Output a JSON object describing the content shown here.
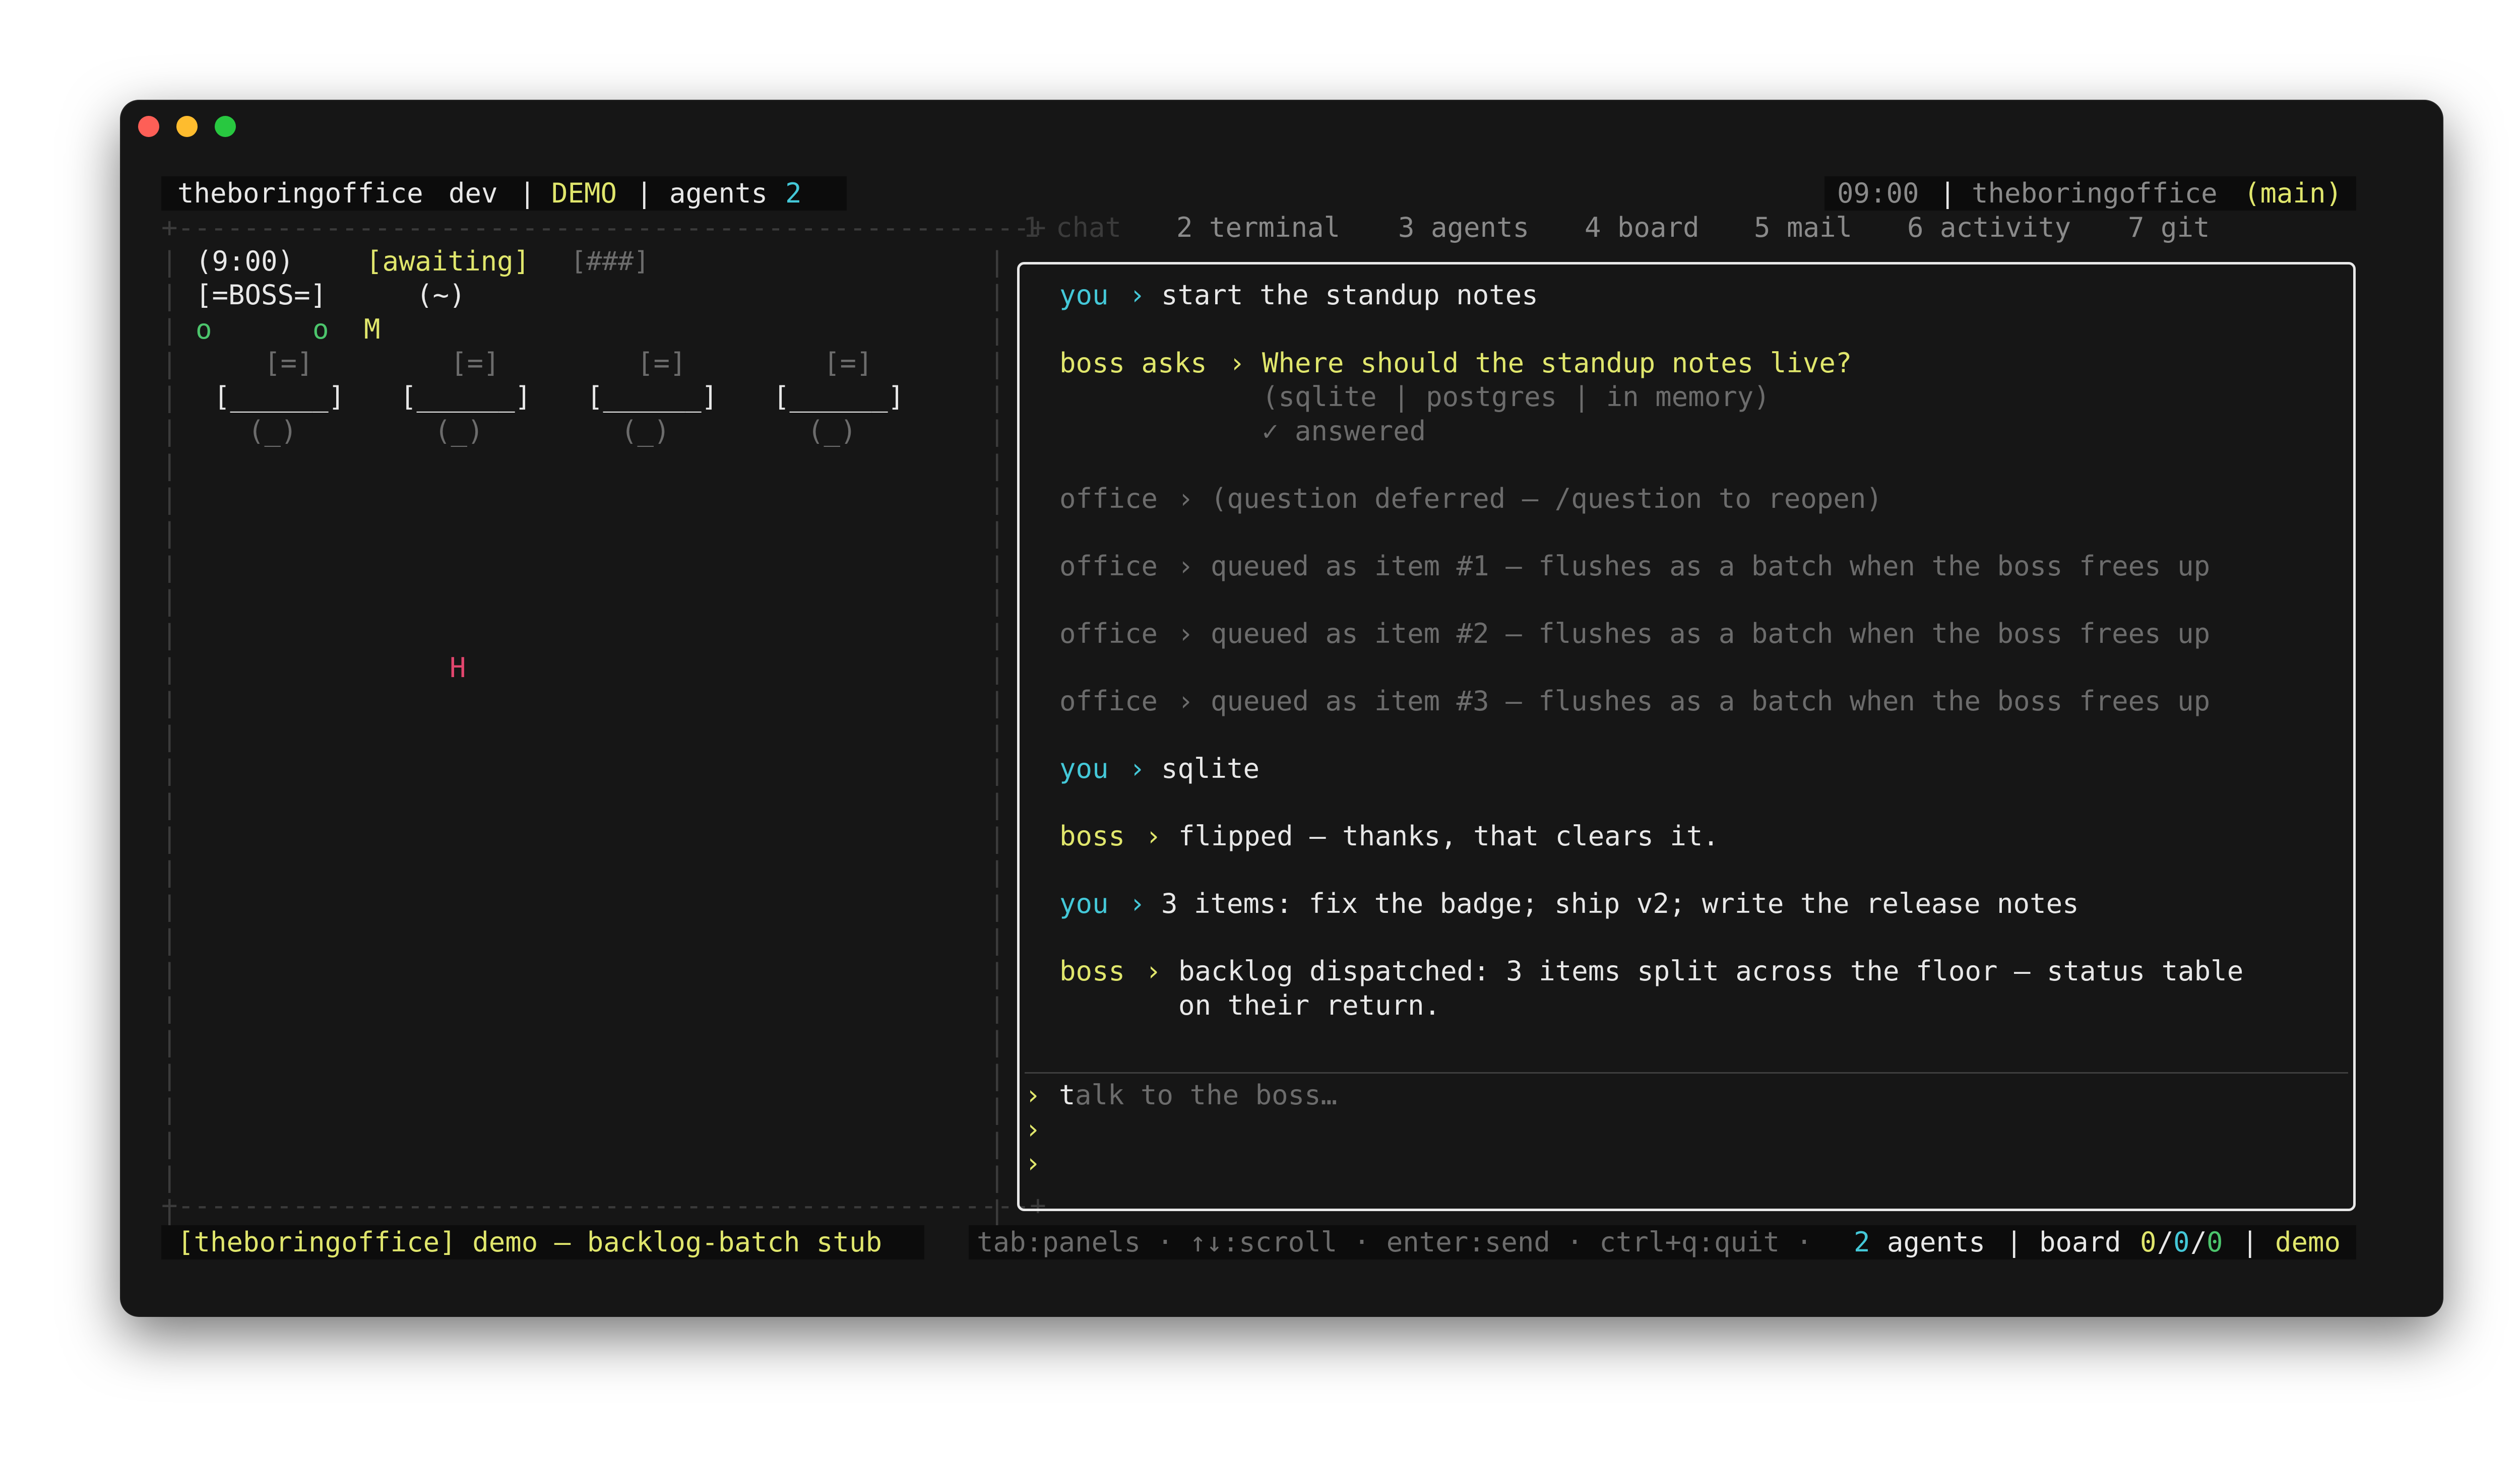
{
  "header": {
    "app_name": "theboringoffice",
    "mode": "dev",
    "sep": "|",
    "demo_label": "DEMO",
    "agents_label": "agents",
    "agents_count": "2",
    "clock": "09:00",
    "repo_name": "theboringoffice",
    "branch": "(main)"
  },
  "tabs": [
    {
      "label": "1 chat"
    },
    {
      "label": "2 terminal"
    },
    {
      "label": "3 agents"
    },
    {
      "label": "4 board"
    },
    {
      "label": "5 mail"
    },
    {
      "label": "6 activity"
    },
    {
      "label": "7 git"
    }
  ],
  "office": {
    "time": "(9:00)",
    "status": "[awaiting]",
    "progress": "[###]",
    "boss_desk": "[=BOSS=]",
    "boss_face": "(~)",
    "agent_a": "o",
    "agent_b": "o",
    "agent_m": "M",
    "monitor": "[=]",
    "desk": "[______]",
    "chair": "(_)",
    "marker_h": "H"
  },
  "chat": {
    "messages": [
      {
        "speaker": "you",
        "sep": "›",
        "text": "start the standup notes"
      },
      {
        "speaker": "boss asks",
        "sep": "›",
        "text": "Where should the standup notes live?",
        "options": "(sqlite | postgres | in memory)",
        "status": "✓ answered"
      },
      {
        "speaker": "office",
        "sep": "›",
        "text": "(question deferred — /question to reopen)"
      },
      {
        "speaker": "office",
        "sep": "›",
        "text": "queued as item #1 — flushes as a batch when the boss frees up"
      },
      {
        "speaker": "office",
        "sep": "›",
        "text": "queued as item #2 — flushes as a batch when the boss frees up"
      },
      {
        "speaker": "office",
        "sep": "›",
        "text": "queued as item #3 — flushes as a batch when the boss frees up"
      },
      {
        "speaker": "you",
        "sep": "›",
        "text": "sqlite"
      },
      {
        "speaker": "boss",
        "sep": "›",
        "text": "flipped — thanks, that clears it."
      },
      {
        "speaker": "you",
        "sep": "›",
        "text": "3 items: fix the badge; ship v2; write the release notes"
      },
      {
        "speaker": "boss",
        "sep": "›",
        "text": "backlog dispatched: 3 items split across the floor — status table",
        "text_cont": "on their return."
      }
    ],
    "input": {
      "prompt": "›",
      "cursor_char": "t",
      "placeholder_rest": "alk to the boss…"
    }
  },
  "footer": {
    "status_text": "[theboringoffice] demo — backlog-batch stub",
    "hints": "tab:panels · ↑↓:scroll · enter:send · ctrl+q:quit ·",
    "agents_count": "2",
    "agents_label": "agents",
    "sep": "|",
    "board_label": "board",
    "board_a": "0",
    "board_slash1": "/",
    "board_b": "0",
    "board_slash2": "/",
    "board_c": "0",
    "demo_label": "demo"
  },
  "colors": {
    "accent_yellow": "#e0e66c",
    "accent_cyan": "#44c8d8",
    "accent_green": "#4cc56c",
    "accent_pink": "#e2466e",
    "window_bg": "#161616"
  }
}
